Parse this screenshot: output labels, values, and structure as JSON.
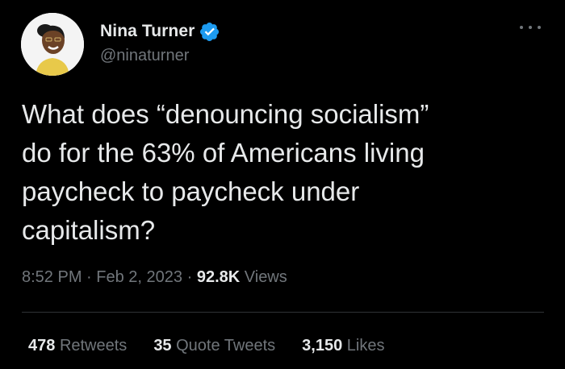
{
  "author": {
    "display_name": "Nina Turner",
    "handle": "@ninaturner",
    "verified": true
  },
  "icons": {
    "avatar": "profile-photo",
    "verified": "verified-badge-icon",
    "more": "more-options-icon"
  },
  "colors": {
    "background": "#000000",
    "text": "#e7e9ea",
    "secondary": "#71767b",
    "verified_blue": "#1d9bf0",
    "divider": "#2f3336"
  },
  "tweet": {
    "text": "What does “denouncing socialism”\ndo for the 63% of Americans living\npaycheck to paycheck under\ncapitalism?",
    "time": "8:52 PM",
    "separator": "·",
    "date": "Feb 2, 2023",
    "views_count": "92.8K",
    "views_label": "Views"
  },
  "stats": {
    "retweets_count": "478",
    "retweets_label": "Retweets",
    "quotes_count": "35",
    "quotes_label": "Quote Tweets",
    "likes_count": "3,150",
    "likes_label": "Likes"
  }
}
